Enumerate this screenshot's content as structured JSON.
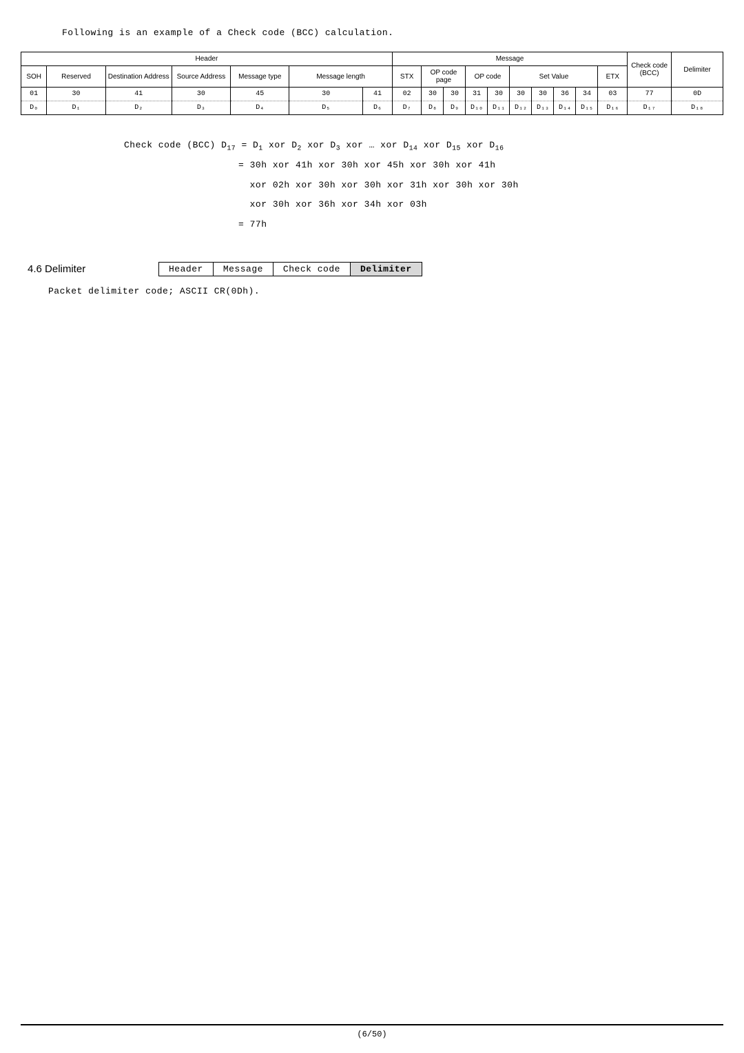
{
  "intro": "Following is an example of a Check code (BCC) calculation.",
  "table": {
    "h_header": "Header",
    "h_message": "Message",
    "h_check": "Check code (BCC)",
    "h_delim": "Delimiter",
    "sub_soh": "SOH",
    "sub_reserved": "Reserved",
    "sub_dest": "Destination Address",
    "sub_src": "Source Address",
    "sub_mtype": "Message type",
    "sub_mlen": "Message length",
    "sub_stx": "STX",
    "sub_opcp": "OP code page",
    "sub_opc": "OP code",
    "sub_setv": "Set Value",
    "sub_etx": "ETX",
    "row1": [
      "01",
      "30",
      "41",
      "30",
      "45",
      "30",
      "41",
      "02",
      "30",
      "30",
      "31",
      "30",
      "30",
      "30",
      "36",
      "34",
      "03",
      "77",
      "0D"
    ],
    "row2": [
      "D₀",
      "D₁",
      "D₂",
      "D₃",
      "D₄",
      "D₅",
      "D₆",
      "D₇",
      "D₈",
      "D₉",
      "D₁₀",
      "D₁₁",
      "D₁₂",
      "D₁₃",
      "D₁₄",
      "D₁₅",
      "D₁₆",
      "D₁₇",
      "D₁₈"
    ]
  },
  "calc": {
    "l1_pre": "Check code (BCC) D",
    "l1_sub1": "17",
    "l1_mid1": " = D",
    "l1_sub2": "1",
    "l1_mid2": " xor D",
    "l1_sub3": "2",
    "l1_mid3": " xor D",
    "l1_sub4": "3",
    "l1_mid4": " xor … xor D",
    "l1_sub5": "14",
    "l1_mid5": " xor D",
    "l1_sub6": "15",
    "l1_mid6": " xor D",
    "l1_sub7": "16",
    "l2": "                    = 30h xor 41h xor 30h xor 45h xor 30h xor 41h",
    "l3": "                      xor 02h xor 30h xor 30h xor 31h xor 30h xor 30h",
    "l4": "                      xor 30h xor 36h xor 34h xor 03h",
    "l5": "                    = 77h"
  },
  "section": {
    "title": "4.6 Delimiter",
    "b1": "Header",
    "b2": "Message",
    "b3": "Check code",
    "b4": "Delimiter"
  },
  "desc": "Packet delimiter code; ASCII CR(0Dh).",
  "footer": "(6/50)"
}
